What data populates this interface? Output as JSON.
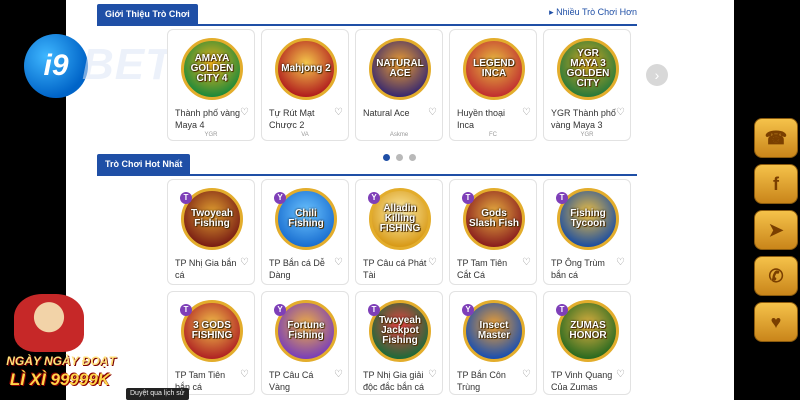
{
  "intro_section": {
    "title": "Giới Thiệu Trò Chơi",
    "more_link": "Nhiều Trò Chơi Hơn",
    "games": [
      {
        "title": "Thành phố vàng Maya 4",
        "provider": "YGR",
        "art": "AMAYA GOLDEN CITY 4",
        "colors": [
          "#1e8a3a",
          "#f2b21a"
        ]
      },
      {
        "title": "Tự Rút Mạt Chược 2",
        "provider": "VA",
        "art": "Mahjong 2",
        "colors": [
          "#b11e1e",
          "#f5c84b"
        ]
      },
      {
        "title": "Natural Ace",
        "provider": "Askme",
        "art": "NATURAL ACE",
        "colors": [
          "#3a2a6e",
          "#f0a030"
        ]
      },
      {
        "title": "Huyền thoại Inca",
        "provider": "FC",
        "art": "LEGEND INCA",
        "colors": [
          "#c13030",
          "#e8c040"
        ]
      },
      {
        "title": "YGR Thành phố vàng Maya 3",
        "provider": "YGR",
        "art": "YGR MAYA 3 GOLDEN CITY",
        "colors": [
          "#2a7a3a",
          "#d8a820"
        ]
      }
    ]
  },
  "hot_section": {
    "title": "Trò Chơi Hot Nhất",
    "games": [
      {
        "title": "TP Nhị Gia bắn cá",
        "badge": "T",
        "art": "Twoyeah Fishing",
        "colors": [
          "#7a1e14",
          "#e0a030"
        ]
      },
      {
        "title": "TP Bắn cá Dễ Dàng",
        "badge": "Y",
        "art": "Chili Fishing",
        "colors": [
          "#1a6fd1",
          "#6cc4ff"
        ]
      },
      {
        "title": "TP Câu cá Phát Tài",
        "badge": "Y",
        "art": "Alladin Killing FISHING",
        "colors": [
          "#d89a18",
          "#fff1b0"
        ]
      },
      {
        "title": "TP Tam Tiên Cắt Cá",
        "badge": "T",
        "art": "Gods Slash Fish",
        "colors": [
          "#8a1e1e",
          "#e8b040"
        ]
      },
      {
        "title": "TP Ông Trùm bắn cá",
        "badge": "T",
        "art": "Fishing Tycoon",
        "colors": [
          "#1e4fa0",
          "#f0c040"
        ]
      },
      {
        "title": "TP Tam Tiên bắn cá",
        "badge": "T",
        "art": "3 GODS FISHING",
        "colors": [
          "#b02424",
          "#f2c24a"
        ]
      },
      {
        "title": "TP Câu Cá Vàng",
        "badge": "Y",
        "art": "Fortune Fishing",
        "colors": [
          "#7a3fb8",
          "#f0b040"
        ]
      },
      {
        "title": "TP Nhị Gia giải độc đắc bắn cá",
        "badge": "T",
        "art": "Twoyeah Jackpot Fishing",
        "colors": [
          "#1e6a3a",
          "#e84040"
        ]
      },
      {
        "title": "TP Bắn Côn Trùng",
        "badge": "Y",
        "art": "Insect Master",
        "colors": [
          "#1a4fb0",
          "#f0a030"
        ]
      },
      {
        "title": "TP Vinh Quang Của Zumas",
        "badge": "T",
        "art": "ZUMAS HONOR",
        "colors": [
          "#2a6a20",
          "#e0b040"
        ]
      }
    ]
  },
  "logo": {
    "badge": "i9",
    "text": "BET"
  },
  "social": [
    "headset-icon",
    "facebook-icon",
    "telegram-icon",
    "phone-icon",
    "gift-heart-icon"
  ],
  "social_glyphs": [
    "☎",
    "f",
    "➤",
    "✆",
    "♥"
  ],
  "promo": {
    "line1": "NGÀY NGÀY ĐOẠT",
    "line2": "LÌ XÌ 99999K"
  },
  "history_text": "Duyệt qua lịch sử"
}
